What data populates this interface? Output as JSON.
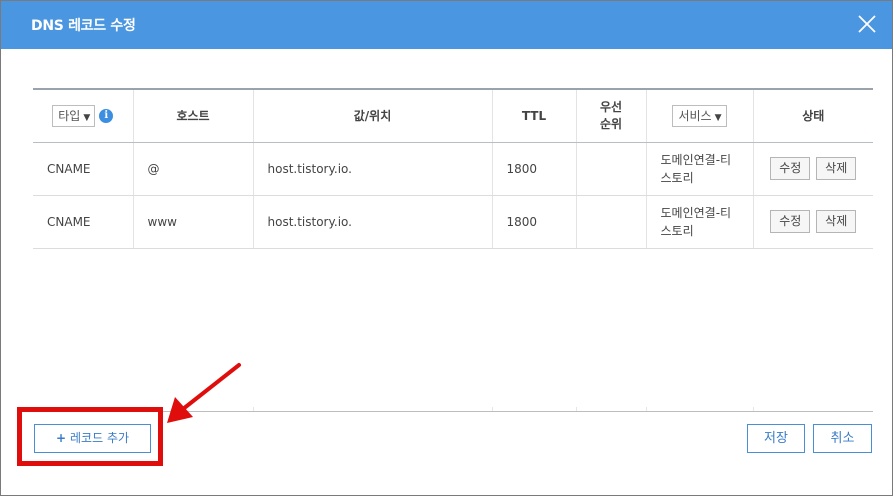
{
  "dialog": {
    "title": "DNS 레코드 수정"
  },
  "table": {
    "headers": {
      "type_select": "타입",
      "host": "호스트",
      "value": "값/위치",
      "ttl": "TTL",
      "priority": "우선\n순위",
      "service_select": "서비스",
      "status": "상태"
    },
    "rows": [
      {
        "type": "CNAME",
        "host": "@",
        "value": "host.tistory.io.",
        "ttl": "1800",
        "priority": "",
        "service_line1": "도메인연결-티",
        "service_line2": "스토리",
        "edit": "수정",
        "delete": "삭제"
      },
      {
        "type": "CNAME",
        "host": "www",
        "value": "host.tistory.io.",
        "ttl": "1800",
        "priority": "",
        "service_line1": "도메인연결-티",
        "service_line2": "스토리",
        "edit": "수정",
        "delete": "삭제"
      }
    ]
  },
  "footer": {
    "add_record_plus": "+",
    "add_record_label": "레코드 추가",
    "save_label": "저장",
    "cancel_label": "취소"
  },
  "colors": {
    "titlebar": "#4a96e0",
    "accent_button": "#4a8fd6",
    "highlight": "#e00d0d"
  },
  "icons": [
    "close-icon",
    "info-icon",
    "chevron-down-icon",
    "red-arrow-annotation"
  ]
}
